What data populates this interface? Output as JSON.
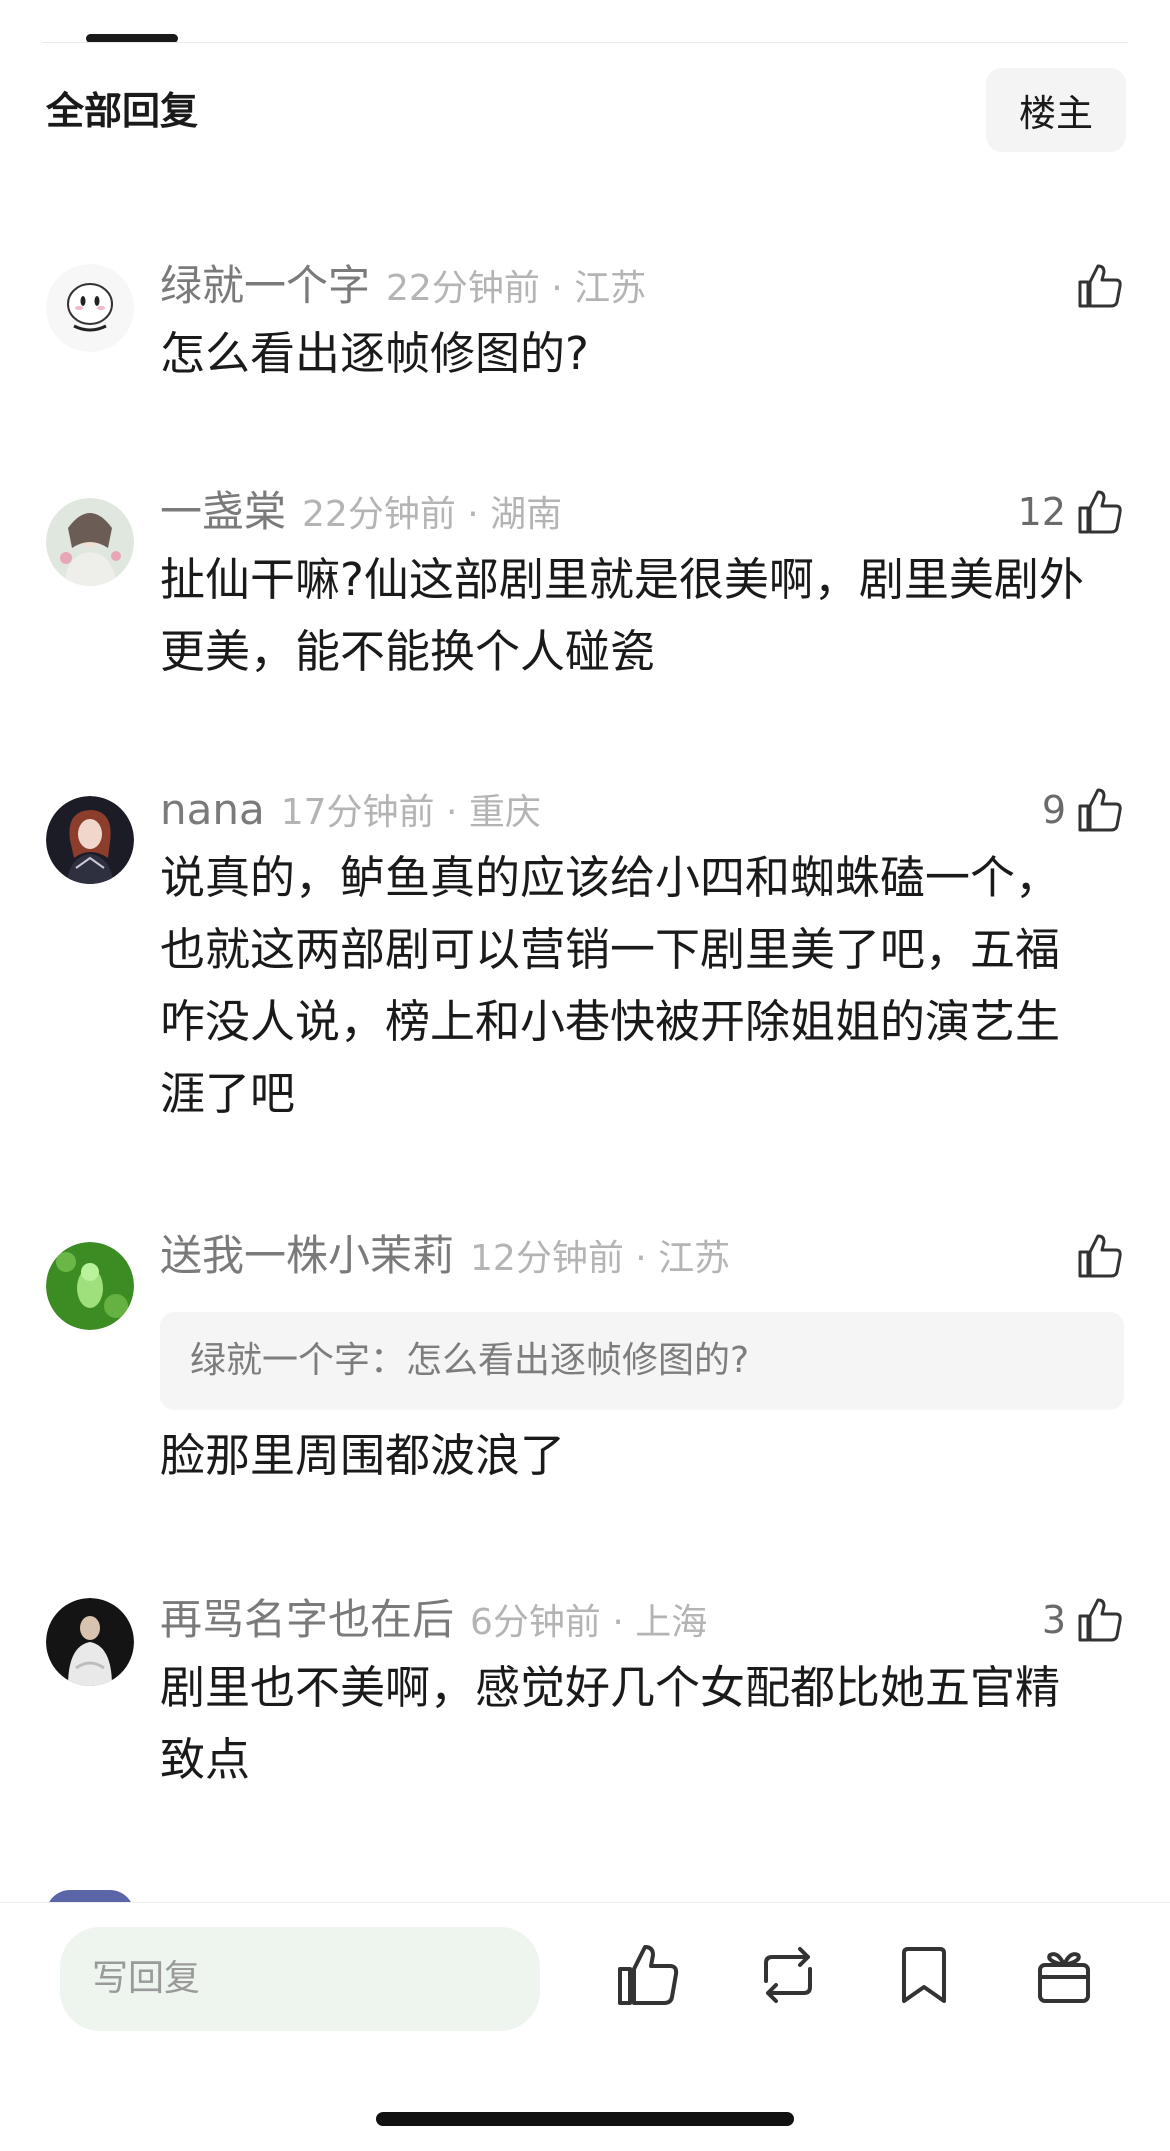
{
  "header": {
    "section_title": "全部回复",
    "owner_button": "楼主"
  },
  "comments": [
    {
      "username": "绿就一个字",
      "time_location": "22分钟前 · 江苏",
      "likes": "",
      "text": "怎么看出逐帧修图的?"
    },
    {
      "username": "一盏棠",
      "time_location": "22分钟前 · 湖南",
      "likes": "12",
      "text": "扯仙干嘛?仙这部剧里就是很美啊，剧里美剧外更美，能不能换个人碰瓷"
    },
    {
      "username": "nana",
      "time_location": "17分钟前 · 重庆",
      "likes": "9",
      "text": "说真的，鲈鱼真的应该给小四和蜘蛛磕一个，也就这两部剧可以营销一下剧里美了吧，五福咋没人说，榜上和小巷快被开除姐姐的演艺生涯了吧"
    },
    {
      "username": "送我一株小茉莉",
      "time_location": "12分钟前 · 江苏",
      "likes": "",
      "quote": "绿就一个字：怎么看出逐帧修图的?",
      "text": "脸那里周围都波浪了"
    },
    {
      "username": "再骂名字也在后",
      "time_location": "6分钟前 · 上海",
      "likes": "3",
      "text": "剧里也不美啊，感觉好几个女配都比她五官精致点"
    }
  ],
  "bottom_bar": {
    "reply_placeholder": "写回复",
    "icons": [
      "thumbs-up-icon",
      "repost-icon",
      "bookmark-icon",
      "gift-icon"
    ]
  },
  "colors": {
    "text": "#1a1a1a",
    "meta": "#b4b4b4",
    "username": "#7a7a7a",
    "reply_bg": "#eef5ef"
  }
}
